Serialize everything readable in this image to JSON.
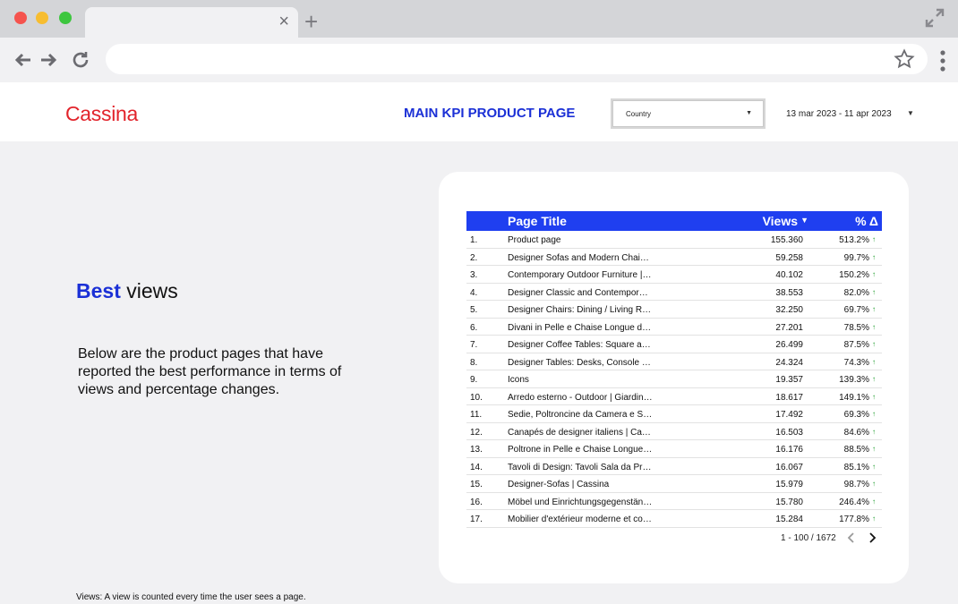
{
  "browser": {
    "tab_close": "×",
    "new_tab": "+"
  },
  "report": {
    "logo": "Cassina",
    "title": "MAIN KPI PRODUCT PAGE",
    "country_label": "Country",
    "date_range": "13 mar 2023 - 11 apr 2023"
  },
  "left": {
    "heading_accent": "Best",
    "heading_rest": " views",
    "description": "Below are the product pages that have reported the best performance in terms of views and percentage changes.",
    "footnote": "Views: A view is counted every time the user sees a page."
  },
  "table": {
    "headers": {
      "title": "Page Title",
      "views": "Views",
      "delta": "% Δ"
    },
    "rows": [
      {
        "idx": "1.",
        "title": "Product page",
        "views": "155.360",
        "pct": "513.2%"
      },
      {
        "idx": "2.",
        "title": "Designer Sofas and Modern Chais…",
        "views": "59.258",
        "pct": "99.7%"
      },
      {
        "idx": "3.",
        "title": "Contemporary Outdoor Furniture | …",
        "views": "40.102",
        "pct": "150.2%"
      },
      {
        "idx": "4.",
        "title": "Designer Classic and Contempora…",
        "views": "38.553",
        "pct": "82.0%"
      },
      {
        "idx": "5.",
        "title": "Designer Chairs: Dining / Living Ro…",
        "views": "32.250",
        "pct": "69.7%"
      },
      {
        "idx": "6.",
        "title": "Divani in Pelle e Chaise Longue di …",
        "views": "27.201",
        "pct": "78.5%"
      },
      {
        "idx": "7.",
        "title": "Designer Coffee Tables: Square a…",
        "views": "26.499",
        "pct": "87.5%"
      },
      {
        "idx": "8.",
        "title": "Designer Tables: Desks, Console a…",
        "views": "24.324",
        "pct": "74.3%"
      },
      {
        "idx": "9.",
        "title": "Icons",
        "views": "19.357",
        "pct": "139.3%"
      },
      {
        "idx": "10.",
        "title": "Arredo esterno - Outdoor | Giardini …",
        "views": "18.617",
        "pct": "149.1%"
      },
      {
        "idx": "11.",
        "title": "Sedie, Poltroncine da Camera e Sg…",
        "views": "17.492",
        "pct": "69.3%"
      },
      {
        "idx": "12.",
        "title": "Canapés de designer italiens | Cas…",
        "views": "16.503",
        "pct": "84.6%"
      },
      {
        "idx": "13.",
        "title": "Poltrone in Pelle e Chaise Longue …",
        "views": "16.176",
        "pct": "88.5%"
      },
      {
        "idx": "14.",
        "title": "Tavoli di Design: Tavoli Sala da Pra…",
        "views": "16.067",
        "pct": "85.1%"
      },
      {
        "idx": "15.",
        "title": "Designer-Sofas | Cassina",
        "views": "15.979",
        "pct": "98.7%"
      },
      {
        "idx": "16.",
        "title": "Möbel und Einrichtungsgegenstän…",
        "views": "15.780",
        "pct": "246.4%"
      },
      {
        "idx": "17.",
        "title": "Mobilier d'extérieur moderne et co…",
        "views": "15.284",
        "pct": "177.8%"
      }
    ],
    "pagination": "1 - 100 / 1672"
  },
  "colors": {
    "brand": "#e2232b",
    "accent": "#1b30d6",
    "header_bg": "#1f3ff0",
    "up_arrow": "#1a9a2a"
  }
}
